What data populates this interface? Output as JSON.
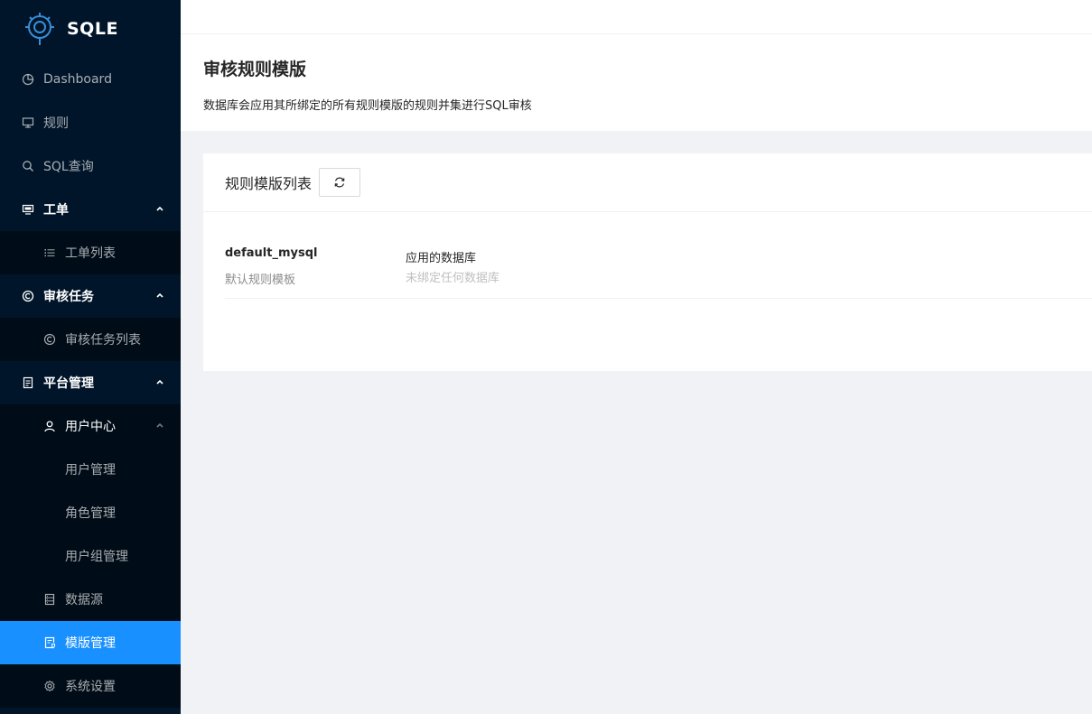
{
  "brand": {
    "name": "SQLE"
  },
  "sidebar": {
    "items": [
      {
        "label": "Dashboard",
        "icon": "pie-chart-icon"
      },
      {
        "label": "规则",
        "icon": "desktop-icon"
      },
      {
        "label": "SQL查询",
        "icon": "search-icon"
      },
      {
        "label": "工单",
        "icon": "console-icon"
      },
      {
        "label": "工单列表",
        "icon": "unordered-list-icon"
      },
      {
        "label": "审核任务",
        "icon": "copyright-icon"
      },
      {
        "label": "审核任务列表",
        "icon": "copyright-icon"
      },
      {
        "label": "平台管理",
        "icon": "file-icon"
      },
      {
        "label": "用户中心",
        "icon": "user-icon"
      },
      {
        "label": "用户管理"
      },
      {
        "label": "角色管理"
      },
      {
        "label": "用户组管理"
      },
      {
        "label": "数据源",
        "icon": "database-icon"
      },
      {
        "label": "模版管理",
        "icon": "file-protect-icon"
      },
      {
        "label": "系统设置",
        "icon": "setting-icon"
      }
    ]
  },
  "page": {
    "title": "审核规则模版",
    "description": "数据库会应用其所绑定的所有规则模版的规则并集进行SQL审核"
  },
  "card": {
    "title": "规则模版列表",
    "refresh_icon": "reload-icon"
  },
  "templates": [
    {
      "name": "default_mysql",
      "description": "默认规则模板",
      "db_label": "应用的数据库",
      "db_value": "未绑定任何数据库"
    }
  ],
  "colors": {
    "sidebar_bg": "#001529",
    "submenu_bg": "#000c17",
    "active": "#1890ff"
  }
}
